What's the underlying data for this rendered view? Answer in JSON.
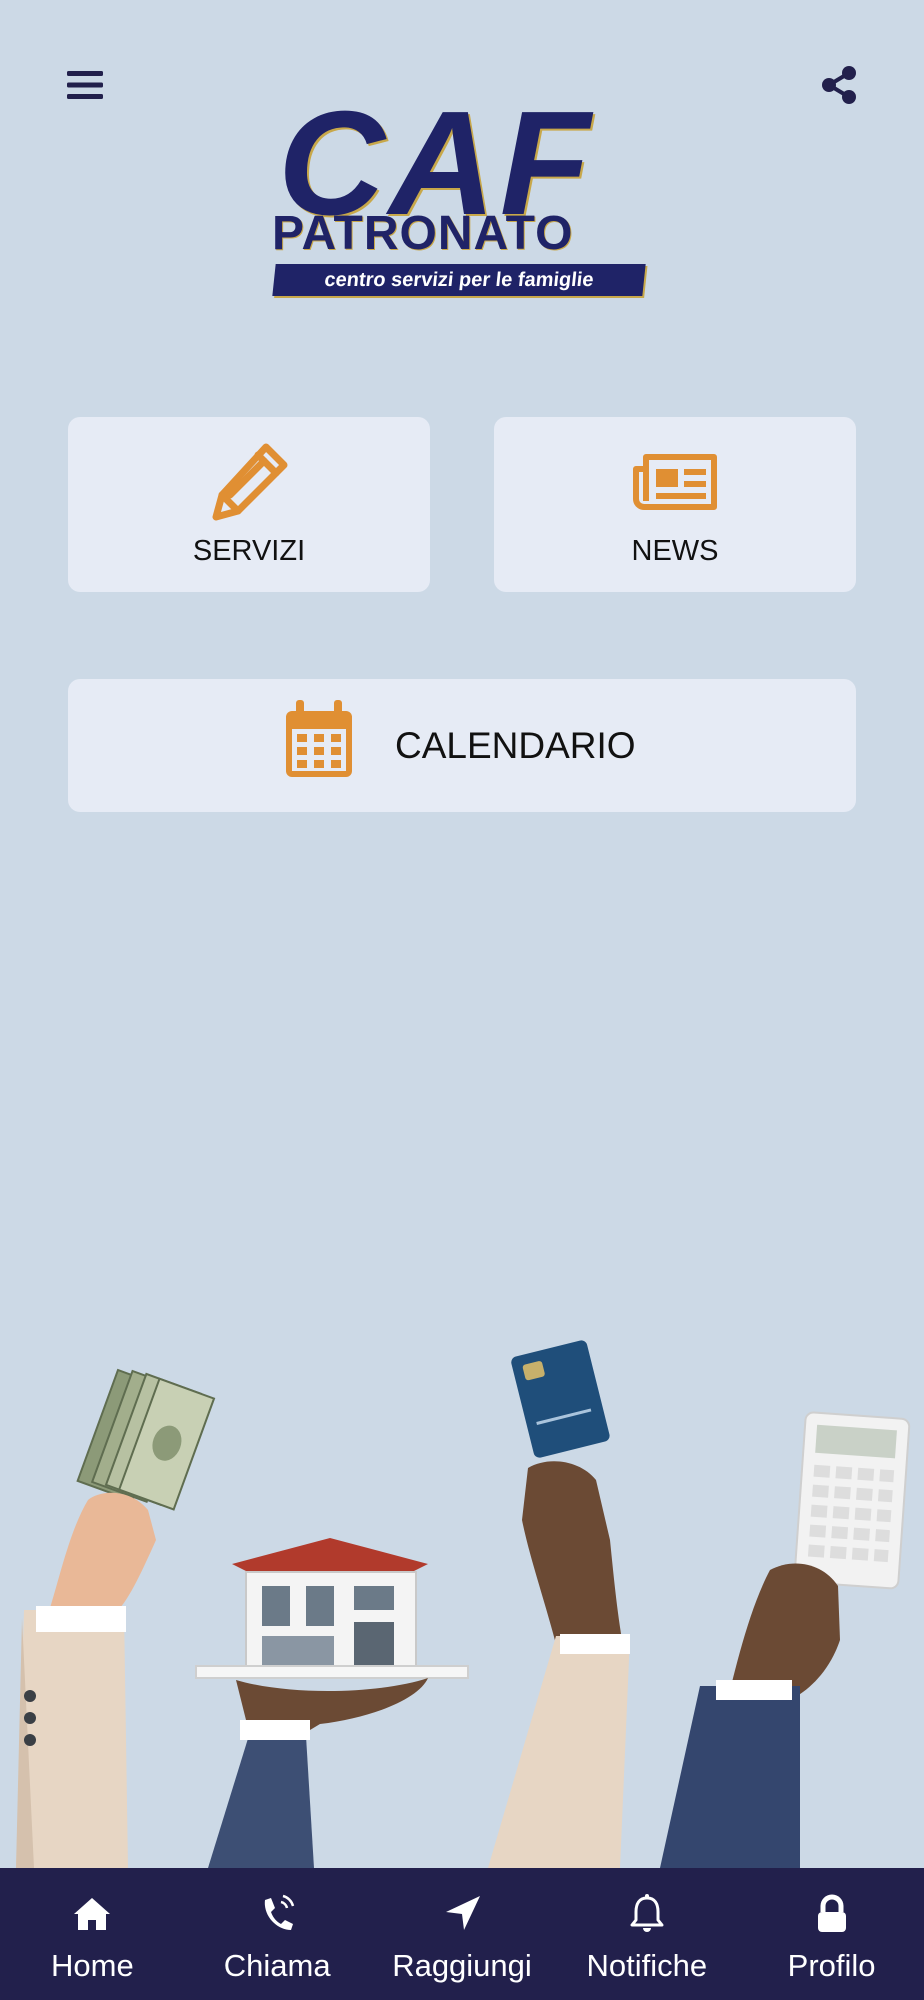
{
  "header": {
    "menu_icon": "hamburger-menu-icon",
    "share_icon": "share-icon"
  },
  "logo": {
    "title": "CAF",
    "subtitle": "PATRONATO",
    "tagline": "centro servizi per le famiglie"
  },
  "cards": {
    "servizi": {
      "label": "SERVIZI",
      "icon": "pencil-icon"
    },
    "news": {
      "label": "NEWS",
      "icon": "newspaper-icon"
    },
    "calendario": {
      "label": "CALENDARIO",
      "icon": "calendar-icon"
    }
  },
  "bottom_nav": {
    "items": [
      {
        "label": "Home",
        "icon": "home-icon"
      },
      {
        "label": "Chiama",
        "icon": "phone-icon"
      },
      {
        "label": "Raggiungi",
        "icon": "location-arrow-icon"
      },
      {
        "label": "Notifiche",
        "icon": "bell-icon"
      },
      {
        "label": "Profilo",
        "icon": "lock-icon"
      }
    ]
  },
  "colors": {
    "background": "#ccd9e6",
    "card": "#e6ebf5",
    "accent": "#e08f33",
    "brand": "#1f2367",
    "nav_background": "#22204c"
  }
}
